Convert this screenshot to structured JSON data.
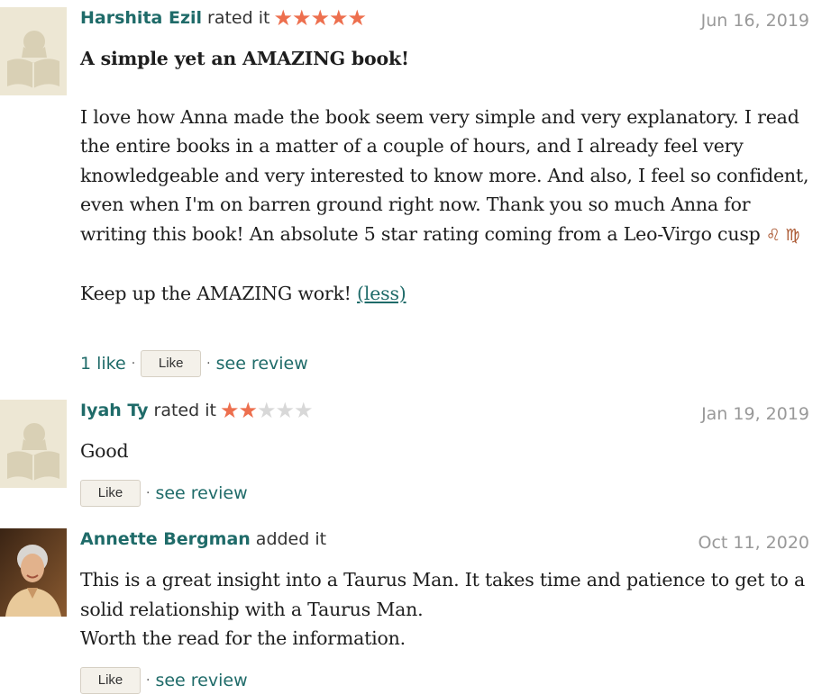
{
  "reviews": [
    {
      "name": "Harshita Ezil",
      "action": "rated it",
      "rating": 5,
      "max_rating": 5,
      "date": "Jun 16, 2019",
      "title": "A simple yet an AMAZING book!",
      "body": "I love how Anna made the book seem very simple and very explanatory. I read the entire books in a matter of a couple of hours, and I already feel very knowledgeable and very interested to know more. And also, I feel so confident, even when I'm on barren ground right now. Thank you so much Anna for writing this book! An absolute 5 star rating coming from a Leo-Virgo cusp",
      "zodiac": "♌ ♍",
      "closing": "Keep up the AMAZING work!",
      "less_link": "(less)",
      "likes": "1 like",
      "like_button": "Like",
      "see_review": "see review",
      "avatar": "default-reader-avatar"
    },
    {
      "name": "Iyah Ty",
      "action": "rated it",
      "rating": 2,
      "max_rating": 5,
      "date": "Jan 19, 2019",
      "body": "Good",
      "like_button": "Like",
      "see_review": "see review",
      "avatar": "default-reader-avatar"
    },
    {
      "name": "Annette Bergman",
      "action": "added it",
      "date": "Oct 11, 2020",
      "body_lines": [
        "This is a great insight into a Taurus Man. It takes time and patience to get to a solid relationship with a Taurus Man.",
        "Worth the read for the information."
      ],
      "like_button": "Like",
      "see_review": "see review",
      "avatar": "user-photo"
    }
  ],
  "colors": {
    "link": "#1f6b69",
    "star_on": "#ed6f4e",
    "star_off": "#d8d8d8",
    "date": "#999999",
    "button_bg": "#f4f1ea"
  }
}
